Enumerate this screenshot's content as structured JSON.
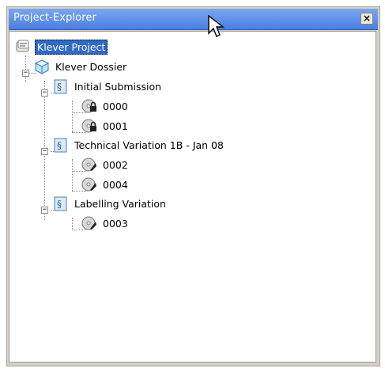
{
  "window": {
    "title": "Project-Explorer",
    "close_glyph": "×"
  },
  "tree": {
    "root": {
      "label": "Klever Project",
      "icon": "project-icon",
      "selected": true
    },
    "dossier": {
      "label": "Klever Dossier",
      "icon": "cube-icon"
    },
    "groups": [
      {
        "label": "Initial Submission",
        "icon": "section-document-icon",
        "items": [
          {
            "label": "0000",
            "icon": "locked-disc-icon"
          },
          {
            "label": "0001",
            "icon": "locked-disc-icon"
          }
        ]
      },
      {
        "label": "Technical Variation 1B - Jan 08",
        "icon": "section-document-icon",
        "items": [
          {
            "label": "0002",
            "icon": "disc-icon"
          },
          {
            "label": "0004",
            "icon": "disc-icon"
          }
        ]
      },
      {
        "label": "Labelling Variation",
        "icon": "section-document-icon",
        "items": [
          {
            "label": "0003",
            "icon": "disc-icon"
          }
        ]
      }
    ]
  },
  "colors": {
    "titlebar": "#4a7ee0",
    "selection": "#316ac5",
    "panel": "#d4d0c8"
  }
}
